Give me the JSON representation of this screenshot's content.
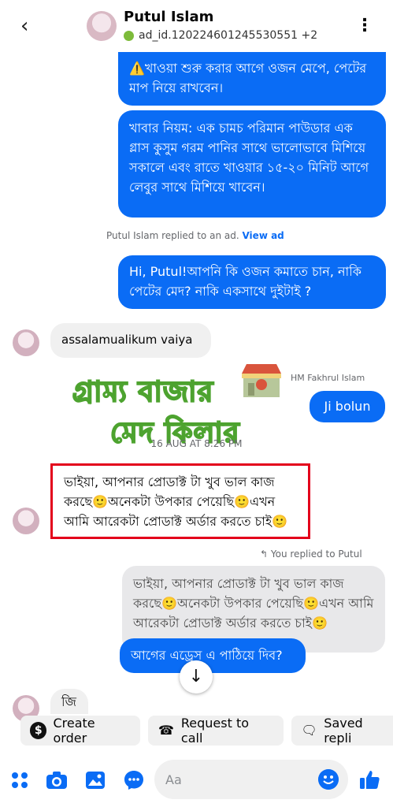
{
  "header": {
    "name": "Putul Islam",
    "subtitle": "ad_id.120224601245530551 +2"
  },
  "messages": {
    "out1": "⚠️খাওয়া শুরু করার আগে ওজন মেপে, পেটের মাপ নিয়ে রাখবেন।",
    "out2": "খাবার নিয়ম: এক চামচ পরিমান পাউডার এক গ্লাস কুসুম গরম পানির সাথে ভালোভাবে মিশিয়ে সকালে এবং রাতে খাওয়ার ১৫-২০ মিনিট আগে লেবুর সাথে মিশিয়ে খাবেন।",
    "reply_note": "Putul Islam replied to an ad.",
    "view_ad": "View ad",
    "out3": "Hi, Putul!আপনি কি ওজন কমাতে চান, নাকি পেটের মেদ? নাকি একসাথে দুইটাই ?",
    "in1": "assalamualikum vaiya",
    "sender": "HM Fakhrul Islam",
    "out4": "Ji bolun",
    "timestamp": "16 AUG AT 8:26 PM",
    "in2": "ভাইয়া, আপনার প্রোডাক্ট টা খুব ভাল কাজ করছে🙂অনেকটা উপকার পেয়েছি🙂এখন আমি আরেকটা প্রোডাক্ট অর্ডার করতে চাই🙂",
    "you_replied": "You replied to Putul",
    "quoted": "ভাইয়া, আপনার প্রোডাক্ট টা খুব ভাল কাজ করছে🙂অনেকটা উপকার পেয়েছি🙂এখন আমি আরেকটা প্রোডাক্ট অর্ডার করতে চাই🙂",
    "out5": "আগের এড্রেস এ পাঠিয়ে দিব?",
    "in3": "জি"
  },
  "watermark": {
    "line1": "গ্রাম্য বাজার",
    "line2": "মেদ কিলার"
  },
  "quick_actions": {
    "create_order": "Create order",
    "request_call": "Request to call",
    "saved_replies": "Saved repli"
  },
  "composer": {
    "placeholder": "Aa"
  },
  "colors": {
    "accent": "#0a6cf5",
    "highlight_border": "#e3001b",
    "watermark_stroke": "#4da32f"
  }
}
